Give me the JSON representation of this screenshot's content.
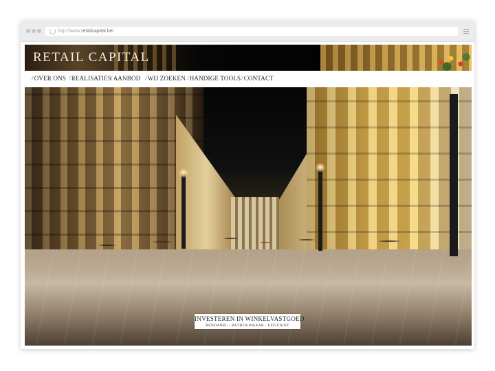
{
  "browser": {
    "url_prefix": "http://www.",
    "url_domain": "retailcapital.be/"
  },
  "site": {
    "logo": "RETAIL CAPITAL",
    "nav": [
      {
        "slash": "/",
        "label": "OVER ONS"
      },
      {
        "slash": "/",
        "label": "REALISATIES"
      },
      {
        "slash": "/",
        "label": "AANBOD"
      },
      {
        "slash": "/",
        "label": "WIJ ZOEKEN"
      },
      {
        "slash": "/",
        "label": "HANDIGE TOOLS"
      },
      {
        "slash": "/",
        "label": "CONTACT"
      }
    ],
    "hero": {
      "tagline_main": "INVESTEREN IN WINKELVASTGOED",
      "tagline_sub": "RENDABEL - BETROUWBAAR - EFFICIENT"
    }
  },
  "colors": {
    "nav_text": "#222222",
    "logo_text": "#f4efe6",
    "chrome_bg": "#ececec"
  },
  "icons": [
    "window-dots-icon",
    "reload-icon",
    "menu-icon"
  ]
}
